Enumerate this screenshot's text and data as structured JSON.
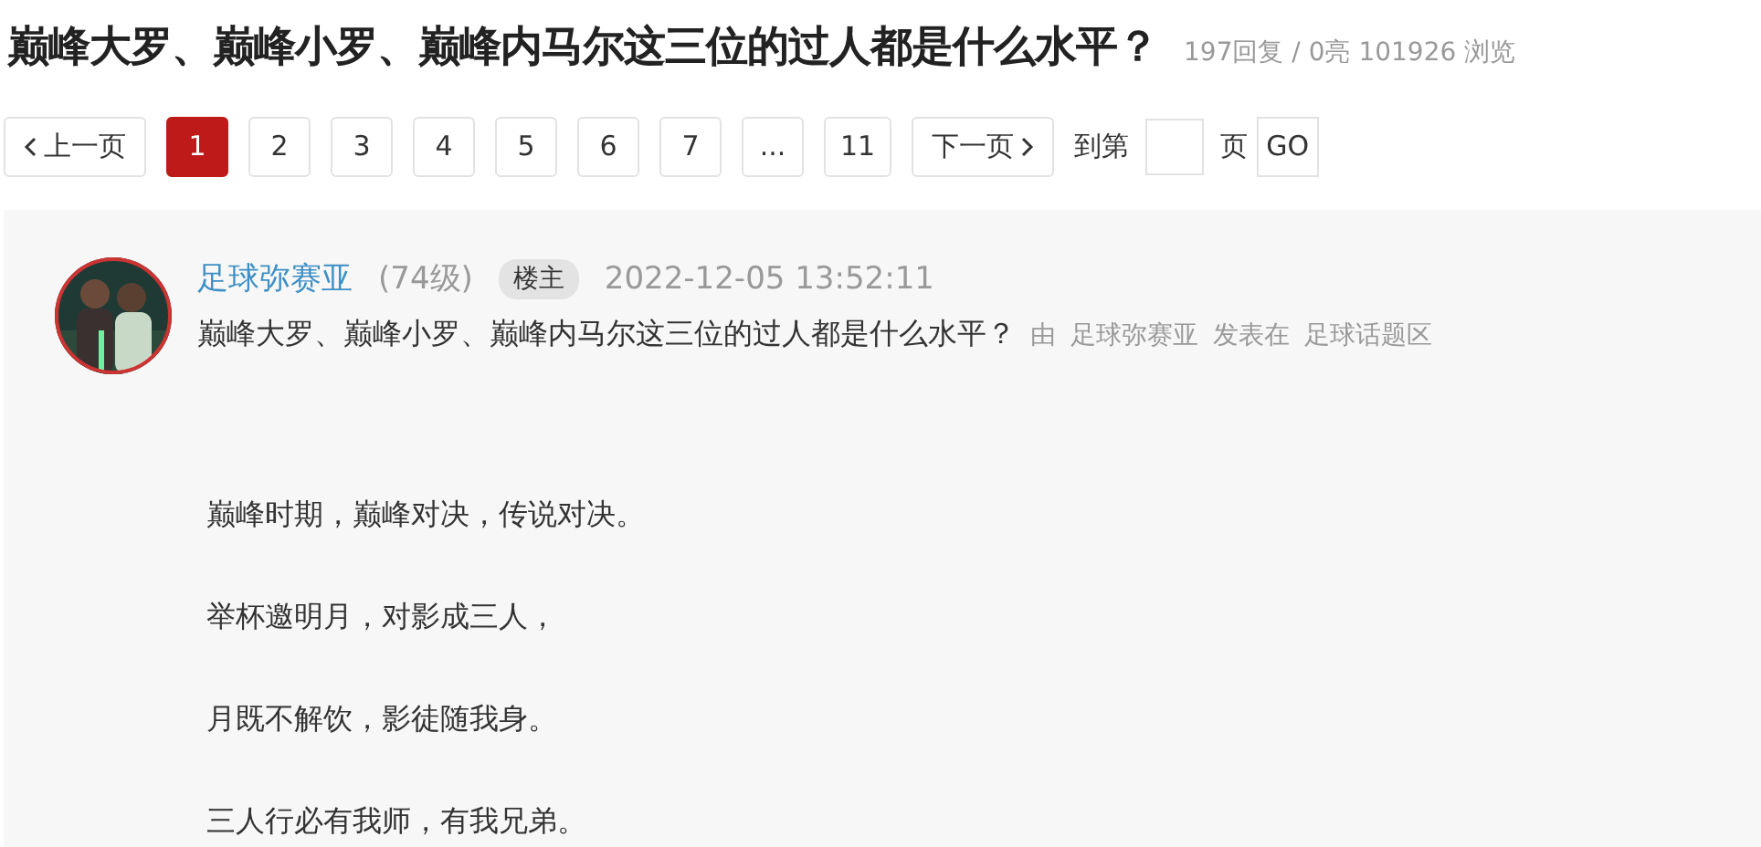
{
  "title": "巅峰大罗、巅峰小罗、巅峰内马尔这三位的过人都是什么水平？",
  "stats": "197回复 / 0亮 101926 浏览",
  "pagination": {
    "prev": "上一页",
    "pages": [
      {
        "label": "1",
        "selected": true
      },
      {
        "label": "2",
        "selected": false
      },
      {
        "label": "3",
        "selected": false
      },
      {
        "label": "4",
        "selected": false
      },
      {
        "label": "5",
        "selected": false
      },
      {
        "label": "6",
        "selected": false
      },
      {
        "label": "7",
        "selected": false
      },
      {
        "label": "...",
        "selected": false
      },
      {
        "label": "11",
        "selected": false
      }
    ],
    "next": "下一页",
    "goto_label": "到第",
    "goto_unit": "页",
    "go": "GO"
  },
  "post": {
    "author": "足球弥赛亚",
    "level": "(74级)",
    "badge": "楼主",
    "time": "2022-12-05 13:52:11",
    "subject": "巅峰大罗、巅峰小罗、巅峰内马尔这三位的过人都是什么水平？",
    "by": "由",
    "by_author": "足球弥赛亚",
    "posted_in": "发表在",
    "forum": "足球话题区",
    "paragraphs": [
      "巅峰时期，巅峰对决，传说对决。",
      "举杯邀明月，对影成三人，",
      "月既不解饮，影徒随我身。",
      "三人行必有我师，有我兄弟。"
    ]
  }
}
